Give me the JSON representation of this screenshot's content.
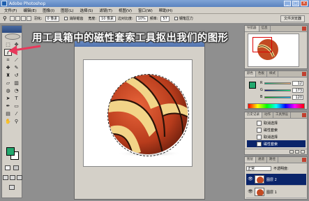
{
  "window": {
    "title": "Adobe Photoshop"
  },
  "menu": [
    "文件(F)",
    "编辑(E)",
    "图像(I)",
    "图层(L)",
    "选择(S)",
    "滤镜(T)",
    "视图(V)",
    "窗口(W)",
    "帮助(H)"
  ],
  "options": {
    "feather_label": "羽化:",
    "feather_value": "0 像素",
    "antialias_label": "消除锯齿",
    "width_label": "宽度:",
    "width_value": "10 像素",
    "edge_contrast_label": "边对比度:",
    "edge_contrast_value": "10%",
    "frequency_label": "频率:",
    "frequency_value": "57",
    "pen_pressure_label": "钢笔压力",
    "file_browser_tab": "文件浏览器"
  },
  "annotation": {
    "text": "用工具箱中的磁性套索工具抠出我们的图形",
    "color": "#ffffff",
    "arrow_color": "#e8385a"
  },
  "colors": {
    "foreground": "#23a86e",
    "background": "#ffffff"
  },
  "panels": {
    "navigator": {
      "tabs": [
        "导航器",
        "信息"
      ]
    },
    "color": {
      "tabs": [
        "颜色",
        "色板",
        "样式"
      ],
      "channels": [
        {
          "label": "R",
          "value": "12"
        },
        {
          "label": "G",
          "value": "173"
        },
        {
          "label": "B",
          "value": "120"
        }
      ]
    },
    "history": {
      "tabs": [
        "历史记录",
        "动作",
        "工具预设"
      ],
      "items": [
        {
          "label": "取消选择",
          "selected": false
        },
        {
          "label": "磁性套索",
          "selected": false
        },
        {
          "label": "取消选择",
          "selected": false
        },
        {
          "label": "磁性套索",
          "selected": true
        }
      ]
    },
    "layers": {
      "tabs": [
        "图层",
        "通道",
        "路径"
      ],
      "blend_mode": "正常",
      "opacity_label": "不透明度:",
      "items": [
        {
          "label": "图层 2",
          "selected": true
        },
        {
          "label": "图层 1",
          "selected": false
        }
      ]
    }
  }
}
